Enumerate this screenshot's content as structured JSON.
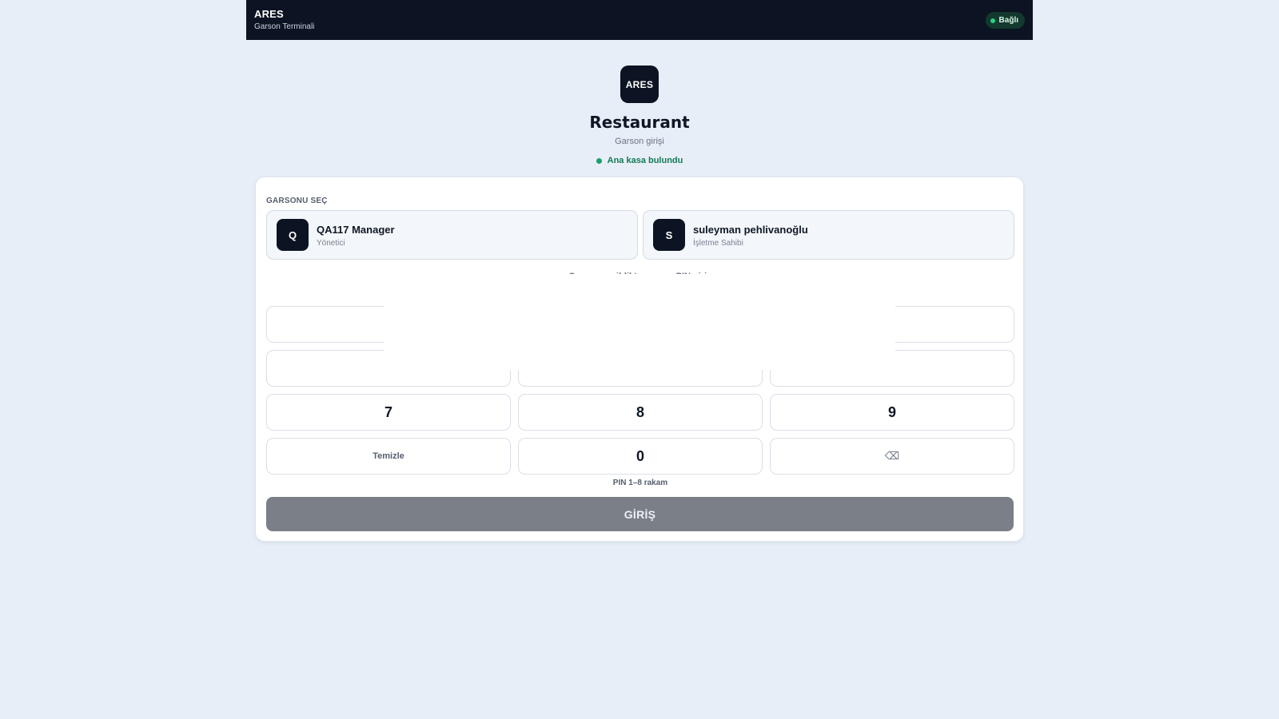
{
  "topbar": {
    "brand": "ARES",
    "subtitle": "Garson Terminali",
    "status": "Bağlı",
    "status_color": "#27d17f"
  },
  "header": {
    "logo": "ARES",
    "title": "Restaurant",
    "subtitle": "Garson girişi",
    "status": "Ana kasa bulundu"
  },
  "card": {
    "section_label": "GARSONU SEÇ",
    "waiters": [
      {
        "initial": "Q",
        "name": "QA117 Manager",
        "role": "Yönetici"
      },
      {
        "initial": "S",
        "name": "suleyman pehlivanoğlu",
        "role": "İşletme Sahibi"
      }
    ],
    "hint": "Garson seçildikten sonra PIN girin",
    "keypad": {
      "row3": [
        "7",
        "8",
        "9"
      ],
      "clear": "Temizle",
      "zero": "0",
      "backspace": "⌫"
    },
    "pin_hint": "PIN 1–8 rakam",
    "login": "GİRİŞ"
  },
  "colors": {
    "dark": "#0c1322",
    "success": "#137a55",
    "disabled_button": "#7a7f88"
  }
}
